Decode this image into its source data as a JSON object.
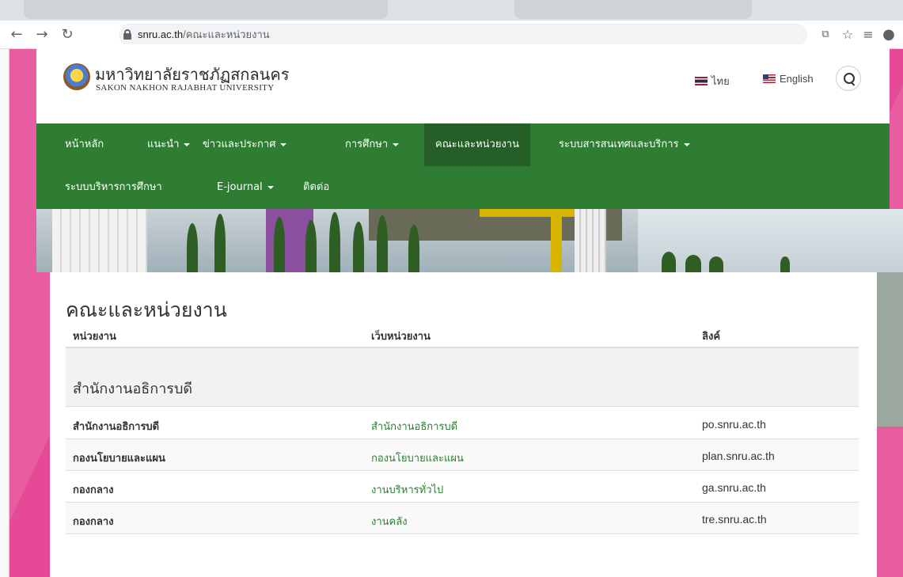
{
  "browser": {
    "url_host": "snru.ac.th",
    "url_path": "/คณะและหน่วยงาน"
  },
  "header": {
    "university_th": "มหาวิทยาลัยราชภัฏสกลนคร",
    "university_en": "SAKON NAKHON RAJABHAT UNIVERSITY",
    "lang_th": "ไทย",
    "lang_en": "English"
  },
  "nav": {
    "items": [
      {
        "label": "หน้าหลัก",
        "dropdown": false
      },
      {
        "label": "แนะนำ",
        "dropdown": true
      },
      {
        "label": "ข่าวและประกาศ",
        "dropdown": true
      },
      {
        "label": "การศึกษา",
        "dropdown": true
      },
      {
        "label": "คณะและหน่วยงาน",
        "dropdown": false,
        "active": true
      },
      {
        "label": "ระบบสารสนเทศและบริการ",
        "dropdown": true
      },
      {
        "label": "ระบบบริหารการศึกษา",
        "dropdown": false
      },
      {
        "label": "E-journal",
        "dropdown": true
      },
      {
        "label": "ติดต่อ",
        "dropdown": false
      }
    ]
  },
  "content": {
    "title": "คณะและหน่วยงาน",
    "columns": [
      "หน่วยงาน",
      "เว็บหน่วยงาน",
      "ลิงค์"
    ],
    "group": "สำนักงานอธิการบดี",
    "rows": [
      {
        "unit": "สำนักงานอธิการบดี",
        "web": "สำนักงานอธิการบดี",
        "link": "po.snru.ac.th"
      },
      {
        "unit": "กองนโยบายและแผน",
        "web": "กองนโยบายและแผน",
        "link": "plan.snru.ac.th"
      },
      {
        "unit": "กองกลาง",
        "web": "งานบริหารทั่วไป",
        "link": "ga.snru.ac.th"
      },
      {
        "unit": "กองกลาง",
        "web": "งานคลัง",
        "link": "tre.snru.ac.th"
      }
    ]
  },
  "colors": {
    "nav_green": "#2e7d32",
    "page_pink": "#e64a96"
  }
}
